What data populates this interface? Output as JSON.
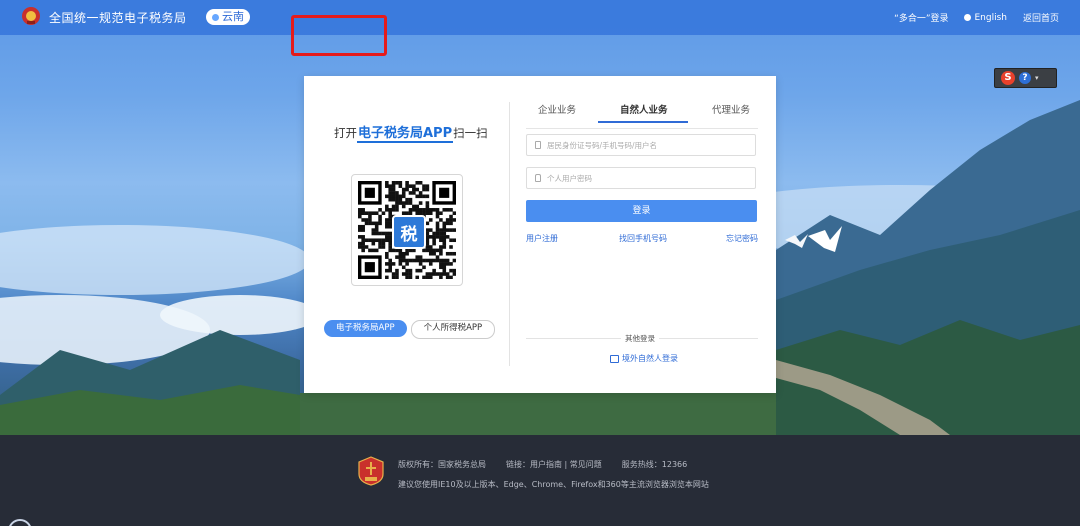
{
  "header": {
    "site_title": "全国统一规范电子税务局",
    "region": "云南",
    "links": [
      "“多合一”登录",
      "English",
      "返回首页"
    ]
  },
  "qr_panel": {
    "title_prefix": "打开",
    "title_highlight": "电子税务局APP",
    "title_suffix": "扫一扫",
    "qr_center_char": "税",
    "app_buttons": [
      "电子税务局APP",
      "个人所得税APP"
    ]
  },
  "login": {
    "tabs": [
      "企业业务",
      "自然人业务",
      "代理业务"
    ],
    "active_tab": "自然人业务",
    "account_placeholder": "居民身份证号码/手机号码/用户名",
    "password_placeholder": "个人用户密码",
    "password_toggle": " ",
    "login_button": "登录",
    "links": [
      "用户注册",
      "找回手机号码",
      "忘记密码"
    ],
    "other_login_label": "其他登录",
    "overseas_login": "境外自然人登录"
  },
  "widget": {
    "s_label": "S",
    "help_label": "?",
    "caret": "▾"
  },
  "footer": {
    "copyright": "版权所有：国家税务总局",
    "links": "链接：用户指南 | 常见问题",
    "hotline": "服务热线：12366",
    "browser_note": "建议您使用IE10及以上版本、Edge、Chrome、Firefox和360等主流浏览器浏览本网站"
  },
  "colors": {
    "accent": "#4a8ef0",
    "header": "#3878dc",
    "highlight_box": "#e51b1b",
    "footer": "#272c37"
  }
}
